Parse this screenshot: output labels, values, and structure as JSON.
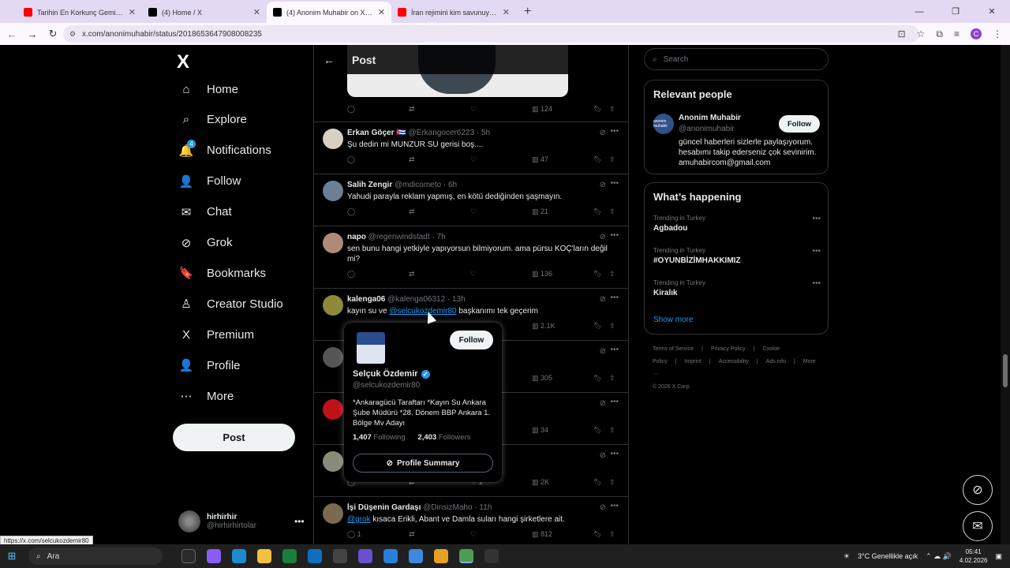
{
  "browser": {
    "tabs": [
      {
        "title": "Tarihin En Korkunç Gemi Vakası",
        "color": "#ff0000",
        "active": false
      },
      {
        "title": "(4) Home / X",
        "color": "#000000",
        "active": false
      },
      {
        "title": "(4) Anonim Muhabir on X: \"Bir İ",
        "color": "#000000",
        "active": true
      },
      {
        "title": "İran rejimini kim savunuyor ve",
        "color": "#ff0000",
        "active": false
      }
    ],
    "url": "x.com/anonimuhabir/status/2018653647908008235"
  },
  "sidebar": {
    "logo": "X",
    "items": [
      {
        "label": "Home",
        "icon": "home-icon",
        "glyph": "⌂"
      },
      {
        "label": "Explore",
        "icon": "search-icon",
        "glyph": "⌕"
      },
      {
        "label": "Notifications",
        "icon": "bell-icon",
        "glyph": "🔔"
      },
      {
        "label": "Follow",
        "icon": "person-add-icon",
        "glyph": "👤"
      },
      {
        "label": "Chat",
        "icon": "envelope-icon",
        "glyph": "✉"
      },
      {
        "label": "Grok",
        "icon": "grok-icon",
        "glyph": "⊘"
      },
      {
        "label": "Bookmarks",
        "icon": "bookmark-icon",
        "glyph": "🔖"
      },
      {
        "label": "Creator Studio",
        "icon": "creator-studio-icon",
        "glyph": "♙"
      },
      {
        "label": "Premium",
        "icon": "x-premium-icon",
        "glyph": "X"
      },
      {
        "label": "Profile",
        "icon": "person-icon",
        "glyph": "👤"
      },
      {
        "label": "More",
        "icon": "more-circle-icon",
        "glyph": "⋯"
      }
    ],
    "notif_badge": "4",
    "post_label": "Post",
    "account": {
      "name": "hirhirhir",
      "handle": "@hirhirhirtolar"
    }
  },
  "feed": {
    "header": "Post",
    "top_actions": {
      "views": "124"
    },
    "replies": [
      {
        "name": "Erkan Göçer 🇨🇺",
        "handle": "@Erkangocer6223 · 5h",
        "text": "Şu dedin mi MUNZUR SU gerisi boş....",
        "reply": "",
        "repost": "",
        "like": "",
        "views": "47",
        "avatar": "#d9d0c4"
      },
      {
        "name": "Salih Zengir",
        "handle": "@mdicometo · 6h",
        "text": "Yahudi parayla reklam yapmış, en kötü dediğinden şaşmayın.",
        "reply": "",
        "repost": "",
        "like": "",
        "views": "21",
        "avatar": "#6b7f95"
      },
      {
        "name": "napo",
        "handle": "@regenwindstadt · 7h",
        "text": "sen bunu hangi yetkiyle yapıyorsun bilmiyorum. ama pürsu KOÇ'ların değil mi?",
        "reply": "",
        "repost": "",
        "like": "",
        "views": "136",
        "avatar": "#b08a79"
      },
      {
        "name": "kalenga06",
        "handle": "@kalenga06312 · 13h",
        "text_before": "kayın su ve ",
        "mention": "@selcukozdemir80",
        "text_after": " başkanımı tek geçerim",
        "reply": "",
        "repost": "",
        "like": "",
        "views": "2.1K",
        "avatar": "#8e8a3a"
      },
      {
        "name": "",
        "handle": "",
        "text": "",
        "reply": "",
        "repost": "",
        "like": "",
        "views": "305",
        "avatar": "#555"
      },
      {
        "name": "",
        "handle": "",
        "text": "",
        "reply": "",
        "repost": "",
        "like": "",
        "views": "34",
        "avatar": "#c0101a"
      },
      {
        "name": "",
        "handle": "14h",
        "text": "",
        "reply": "",
        "repost": "",
        "like": "1",
        "views": "2K",
        "avatar": "#8a8a7a"
      },
      {
        "name": "İşi Düşenin Gardaşı",
        "handle": "@DinsizMaho · 11h",
        "mention": "@grok",
        "text_after": " kısaca Erikli, Abant ve Damla suları hangi şirketlere ait.",
        "reply": "1",
        "repost": "",
        "like": "",
        "views": "812",
        "avatar": "#7a6a50"
      }
    ]
  },
  "hovercard": {
    "name": "Selçuk Özdemir",
    "handle": "@selcukozdemir80",
    "follow_label": "Follow",
    "bio": "*Ankaragücü Taraftarı *Kayın Su Ankara Şube Müdürü *28. Dönem BBP Ankara 1. Bölge Mv Adayı",
    "following_count": "1,407",
    "following_label": "Following",
    "followers_count": "2,403",
    "followers_label": "Followers",
    "summary_label": "Profile Summary"
  },
  "right": {
    "search_placeholder": "Search",
    "relevant_title": "Relevant people",
    "person": {
      "name": "Anonim Muhabir",
      "handle": "@anonimuhabir",
      "follow": "Follow",
      "bio": "güncel haberleri sizlerle paylaşıyorum. hesabımı takip ederseniz çok sevinirim. amuhabircom@gmail.com",
      "avatar_text": "anonim muhabir"
    },
    "happening_title": "What’s happening",
    "trends": [
      {
        "context": "Trending in Turkey",
        "name": "Agbadou"
      },
      {
        "context": "Trending in Turkey",
        "name": "#OYUNBİZİMHAKKIMIZ"
      },
      {
        "context": "Trending in Turkey",
        "name": "Kiralık"
      }
    ],
    "show_more": "Show more",
    "footer": [
      "Terms of Service",
      "|",
      "Privacy Policy",
      "|",
      "Cookie Policy",
      "|",
      "Imprint",
      "|",
      "Accessibility",
      "|",
      "Ads info",
      "|",
      "More ···",
      "© 2026 X Corp."
    ]
  },
  "status_link": "https://x.com/selcukozdemir80",
  "taskbar": {
    "search": "Ara",
    "weather": "3°C Genellikle açık",
    "time": "05:41",
    "date": "4.02.2026"
  }
}
